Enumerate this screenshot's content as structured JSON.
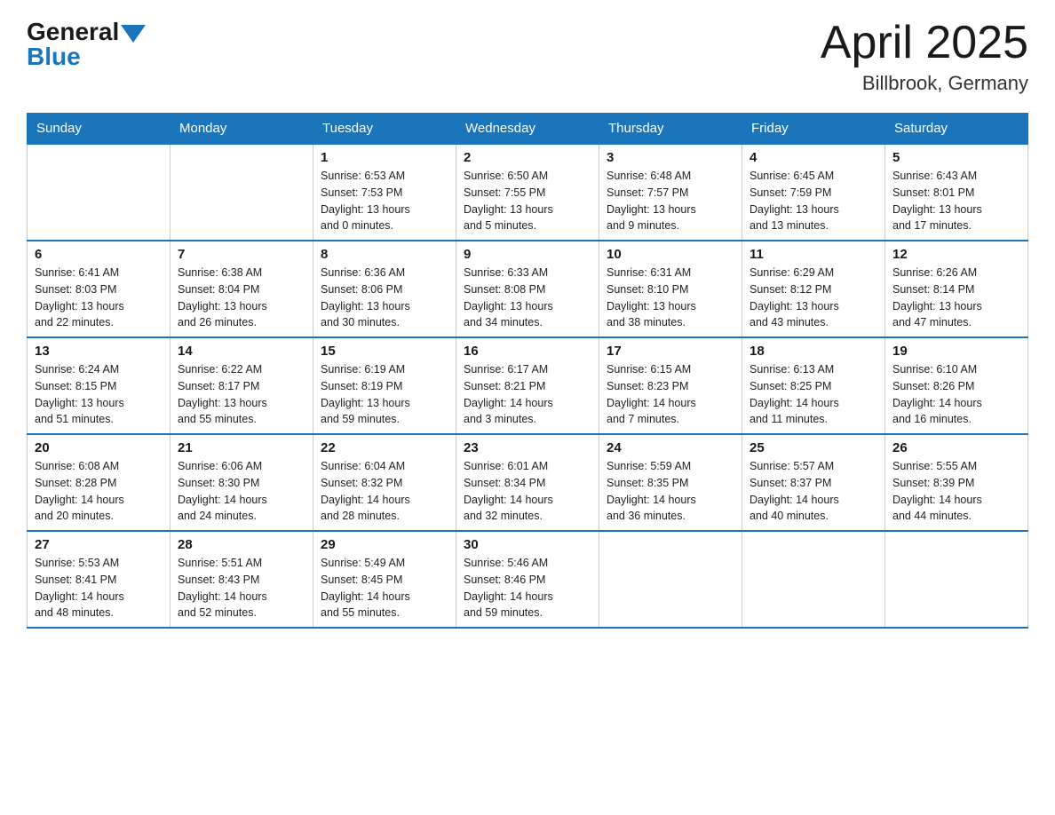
{
  "header": {
    "logo_general": "General",
    "logo_blue": "Blue",
    "title": "April 2025",
    "location": "Billbrook, Germany"
  },
  "calendar": {
    "days_of_week": [
      "Sunday",
      "Monday",
      "Tuesday",
      "Wednesday",
      "Thursday",
      "Friday",
      "Saturday"
    ],
    "weeks": [
      [
        {
          "day": "",
          "info": ""
        },
        {
          "day": "",
          "info": ""
        },
        {
          "day": "1",
          "info": "Sunrise: 6:53 AM\nSunset: 7:53 PM\nDaylight: 13 hours\nand 0 minutes."
        },
        {
          "day": "2",
          "info": "Sunrise: 6:50 AM\nSunset: 7:55 PM\nDaylight: 13 hours\nand 5 minutes."
        },
        {
          "day": "3",
          "info": "Sunrise: 6:48 AM\nSunset: 7:57 PM\nDaylight: 13 hours\nand 9 minutes."
        },
        {
          "day": "4",
          "info": "Sunrise: 6:45 AM\nSunset: 7:59 PM\nDaylight: 13 hours\nand 13 minutes."
        },
        {
          "day": "5",
          "info": "Sunrise: 6:43 AM\nSunset: 8:01 PM\nDaylight: 13 hours\nand 17 minutes."
        }
      ],
      [
        {
          "day": "6",
          "info": "Sunrise: 6:41 AM\nSunset: 8:03 PM\nDaylight: 13 hours\nand 22 minutes."
        },
        {
          "day": "7",
          "info": "Sunrise: 6:38 AM\nSunset: 8:04 PM\nDaylight: 13 hours\nand 26 minutes."
        },
        {
          "day": "8",
          "info": "Sunrise: 6:36 AM\nSunset: 8:06 PM\nDaylight: 13 hours\nand 30 minutes."
        },
        {
          "day": "9",
          "info": "Sunrise: 6:33 AM\nSunset: 8:08 PM\nDaylight: 13 hours\nand 34 minutes."
        },
        {
          "day": "10",
          "info": "Sunrise: 6:31 AM\nSunset: 8:10 PM\nDaylight: 13 hours\nand 38 minutes."
        },
        {
          "day": "11",
          "info": "Sunrise: 6:29 AM\nSunset: 8:12 PM\nDaylight: 13 hours\nand 43 minutes."
        },
        {
          "day": "12",
          "info": "Sunrise: 6:26 AM\nSunset: 8:14 PM\nDaylight: 13 hours\nand 47 minutes."
        }
      ],
      [
        {
          "day": "13",
          "info": "Sunrise: 6:24 AM\nSunset: 8:15 PM\nDaylight: 13 hours\nand 51 minutes."
        },
        {
          "day": "14",
          "info": "Sunrise: 6:22 AM\nSunset: 8:17 PM\nDaylight: 13 hours\nand 55 minutes."
        },
        {
          "day": "15",
          "info": "Sunrise: 6:19 AM\nSunset: 8:19 PM\nDaylight: 13 hours\nand 59 minutes."
        },
        {
          "day": "16",
          "info": "Sunrise: 6:17 AM\nSunset: 8:21 PM\nDaylight: 14 hours\nand 3 minutes."
        },
        {
          "day": "17",
          "info": "Sunrise: 6:15 AM\nSunset: 8:23 PM\nDaylight: 14 hours\nand 7 minutes."
        },
        {
          "day": "18",
          "info": "Sunrise: 6:13 AM\nSunset: 8:25 PM\nDaylight: 14 hours\nand 11 minutes."
        },
        {
          "day": "19",
          "info": "Sunrise: 6:10 AM\nSunset: 8:26 PM\nDaylight: 14 hours\nand 16 minutes."
        }
      ],
      [
        {
          "day": "20",
          "info": "Sunrise: 6:08 AM\nSunset: 8:28 PM\nDaylight: 14 hours\nand 20 minutes."
        },
        {
          "day": "21",
          "info": "Sunrise: 6:06 AM\nSunset: 8:30 PM\nDaylight: 14 hours\nand 24 minutes."
        },
        {
          "day": "22",
          "info": "Sunrise: 6:04 AM\nSunset: 8:32 PM\nDaylight: 14 hours\nand 28 minutes."
        },
        {
          "day": "23",
          "info": "Sunrise: 6:01 AM\nSunset: 8:34 PM\nDaylight: 14 hours\nand 32 minutes."
        },
        {
          "day": "24",
          "info": "Sunrise: 5:59 AM\nSunset: 8:35 PM\nDaylight: 14 hours\nand 36 minutes."
        },
        {
          "day": "25",
          "info": "Sunrise: 5:57 AM\nSunset: 8:37 PM\nDaylight: 14 hours\nand 40 minutes."
        },
        {
          "day": "26",
          "info": "Sunrise: 5:55 AM\nSunset: 8:39 PM\nDaylight: 14 hours\nand 44 minutes."
        }
      ],
      [
        {
          "day": "27",
          "info": "Sunrise: 5:53 AM\nSunset: 8:41 PM\nDaylight: 14 hours\nand 48 minutes."
        },
        {
          "day": "28",
          "info": "Sunrise: 5:51 AM\nSunset: 8:43 PM\nDaylight: 14 hours\nand 52 minutes."
        },
        {
          "day": "29",
          "info": "Sunrise: 5:49 AM\nSunset: 8:45 PM\nDaylight: 14 hours\nand 55 minutes."
        },
        {
          "day": "30",
          "info": "Sunrise: 5:46 AM\nSunset: 8:46 PM\nDaylight: 14 hours\nand 59 minutes."
        },
        {
          "day": "",
          "info": ""
        },
        {
          "day": "",
          "info": ""
        },
        {
          "day": "",
          "info": ""
        }
      ]
    ]
  }
}
